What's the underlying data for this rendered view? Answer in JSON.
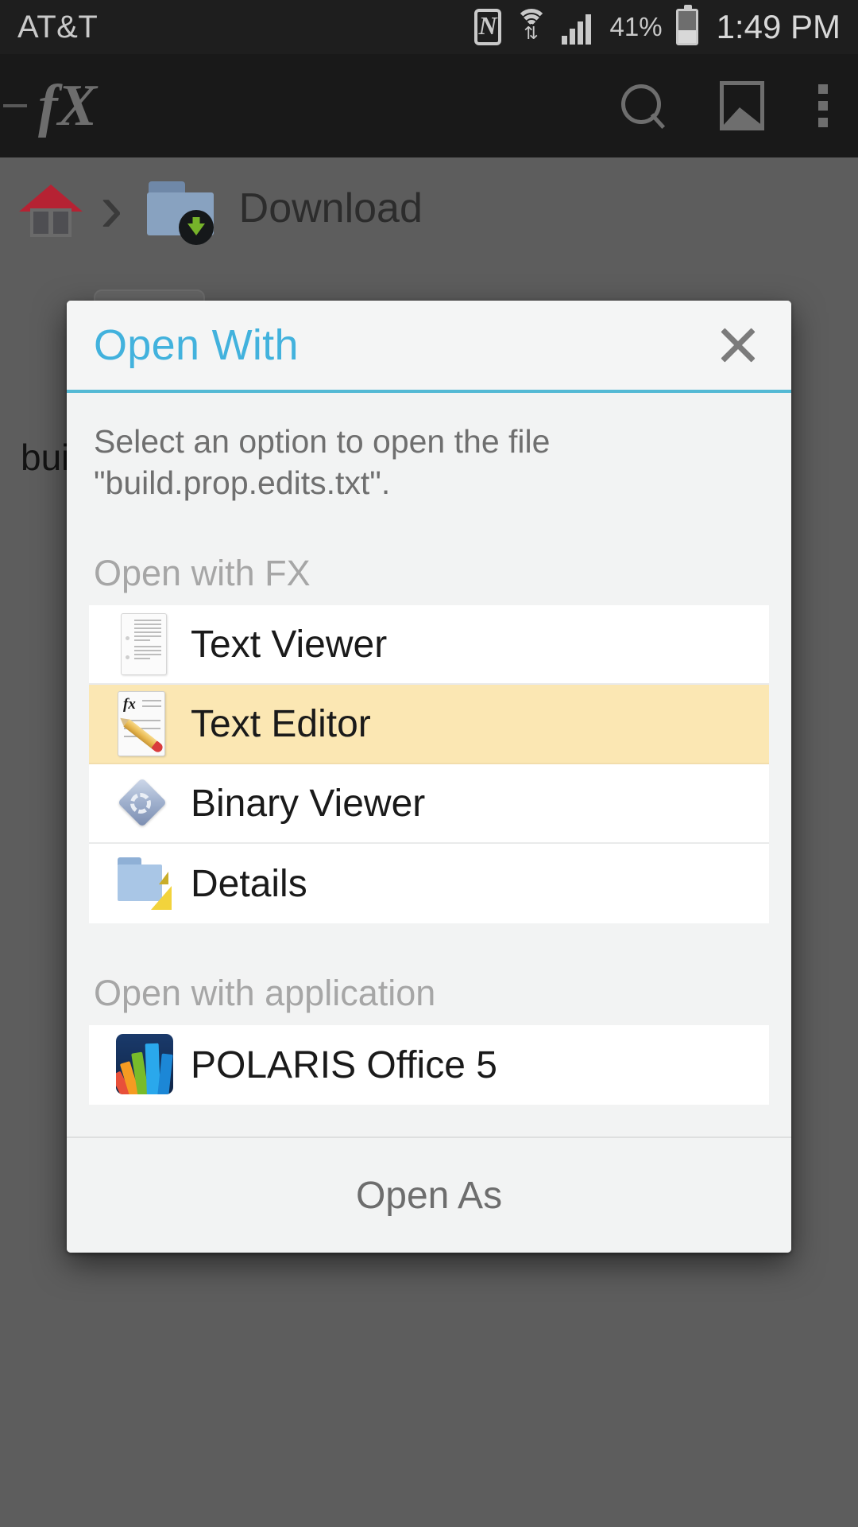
{
  "status_bar": {
    "carrier": "AT&T",
    "battery_percent": "41%",
    "clock": "1:49 PM",
    "icons": [
      "nfc-icon",
      "wifi-icon",
      "signal-icon",
      "battery-icon"
    ]
  },
  "app_bar": {
    "logo": "fX",
    "actions": [
      "search-icon",
      "gallery-icon",
      "overflow-menu-icon"
    ]
  },
  "breadcrumb": {
    "home": "home-icon",
    "separator": "›",
    "current_folder": "Download"
  },
  "background": {
    "partial_filename": "bui"
  },
  "dialog": {
    "title": "Open With",
    "close_label": "×",
    "description": "Select an option to open the file \"build.prop.edits.txt\".",
    "sections": [
      {
        "header": "Open with FX",
        "items": [
          {
            "label": "Text Viewer",
            "icon": "text-document-icon",
            "selected": false
          },
          {
            "label": "Text Editor",
            "icon": "text-editor-icon",
            "selected": true
          },
          {
            "label": "Binary Viewer",
            "icon": "binary-diamond-icon",
            "selected": false
          },
          {
            "label": "Details",
            "icon": "folder-ruler-icon",
            "selected": false
          }
        ]
      },
      {
        "header": "Open with application",
        "items": [
          {
            "label": "POLARIS Office 5",
            "icon": "polaris-office-icon",
            "selected": false
          }
        ]
      }
    ],
    "footer_button": "Open As"
  },
  "colors": {
    "accent": "#42b2dd",
    "accent_rule": "#54b9d4",
    "selected_row": "#fbe7b3",
    "dialog_bg": "#f2f3f3",
    "row_bg": "#ffffff",
    "scrim": "#5d5d5d",
    "status_bar_bg": "#1e1e1e",
    "app_bar_bg": "#191919"
  }
}
